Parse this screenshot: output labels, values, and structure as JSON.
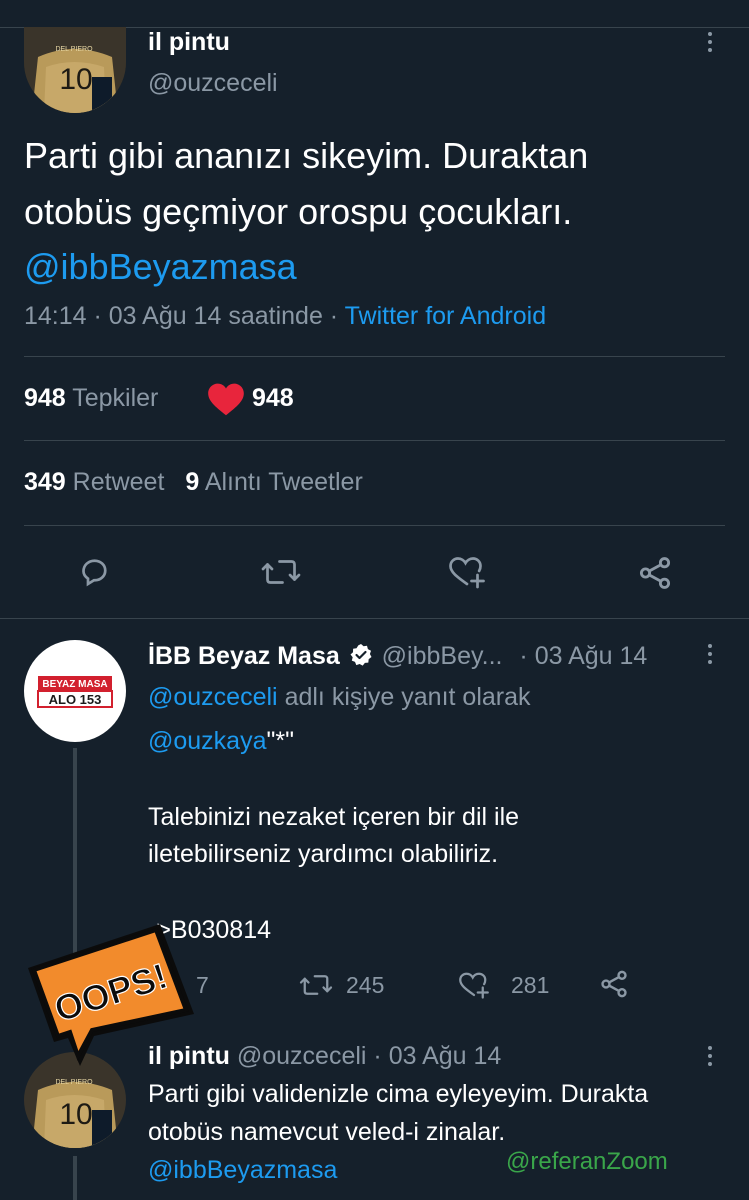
{
  "main_tweet": {
    "author_name": "il pintu",
    "author_handle": "@ouzceceli",
    "text_line1": "Parti gibi ananızı sikeyim. Duraktan",
    "text_line2": "otobüs geçmiyor orospu çocukları.",
    "mention": "@ibbBeyazmasa",
    "timestamp": "14:14 · 03 Ağu 14 saatinde ·",
    "source": "Twitter for Android",
    "reactions_count": "948",
    "reactions_label": "Tepkiler",
    "likes_count": "948",
    "retweet_count": "349",
    "retweet_label": "Retweet",
    "quote_count": "9",
    "quote_label": "Alıntı Tweetler",
    "avatar_number": "10",
    "avatar_text": "DEL PIERO"
  },
  "reply_tweet": {
    "author_name": "İBB Beyaz Masa",
    "author_handle": "@ibbBey...",
    "date": "· 03 Ağu 14",
    "reply_to_handle": "@ouzceceli",
    "reply_to_label": "adlı kişiye yanıt olarak",
    "line1_mention": "@ouzkaya",
    "line1_rest": "\"*\"",
    "line2": "Talebinizi nezaket içeren bir dil ile",
    "line3": "iletebilirseniz yardımcı olabiliriz.",
    "line4": "->B030814",
    "reply_count": "7",
    "retweet_count": "245",
    "like_count": "281",
    "logo_top": "BEYAZ MASA",
    "logo_bottom": "ALO 153"
  },
  "third_tweet": {
    "author_name": "il pintu",
    "meta": "@ouzceceli · 03 Ağu 14",
    "line1": "Parti gibi validenizle cima eyleyeyim. Durakta",
    "line2": "otobüs namevcut veled-i zinalar.",
    "mention": "@ibbBeyazmasa"
  },
  "overlay": {
    "sticker_text": "OOPS!",
    "watermark": "@referanZoom"
  },
  "colors": {
    "background": "#15202b",
    "divider": "#38444d",
    "link": "#1d9bf0",
    "muted": "#8b98a5",
    "heart": "#f91880",
    "sticker_orange": "#f28b2c"
  },
  "icons": [
    "more-icon",
    "reply-icon",
    "retweet-icon",
    "like-icon",
    "share-icon",
    "verified-icon",
    "heart-icon"
  ]
}
